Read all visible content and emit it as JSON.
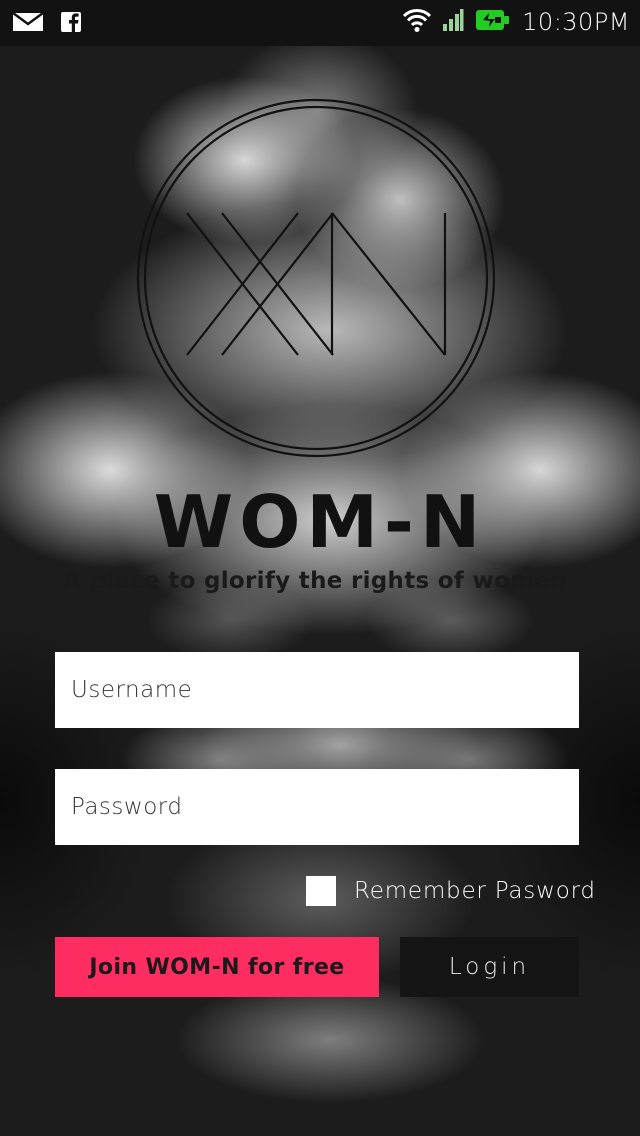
{
  "status_bar": {
    "left_icons": [
      "mail-icon",
      "facebook-icon"
    ],
    "right_icons": [
      "wifi-icon",
      "signal-icon",
      "battery-charging-icon"
    ],
    "time": "10:30PM",
    "battery_color": "#22cc22"
  },
  "brand": {
    "title": "WOM-N",
    "tagline": "A place to glorify the rights of women"
  },
  "form": {
    "username_placeholder": "Username",
    "password_placeholder": "Password",
    "remember_label": "Remember Pasword",
    "remember_checked": false
  },
  "buttons": {
    "join_label": "Join WOM-N for free",
    "login_label": "Login"
  },
  "colors": {
    "accent": "#fd2d62",
    "login_bg": "#141414"
  }
}
